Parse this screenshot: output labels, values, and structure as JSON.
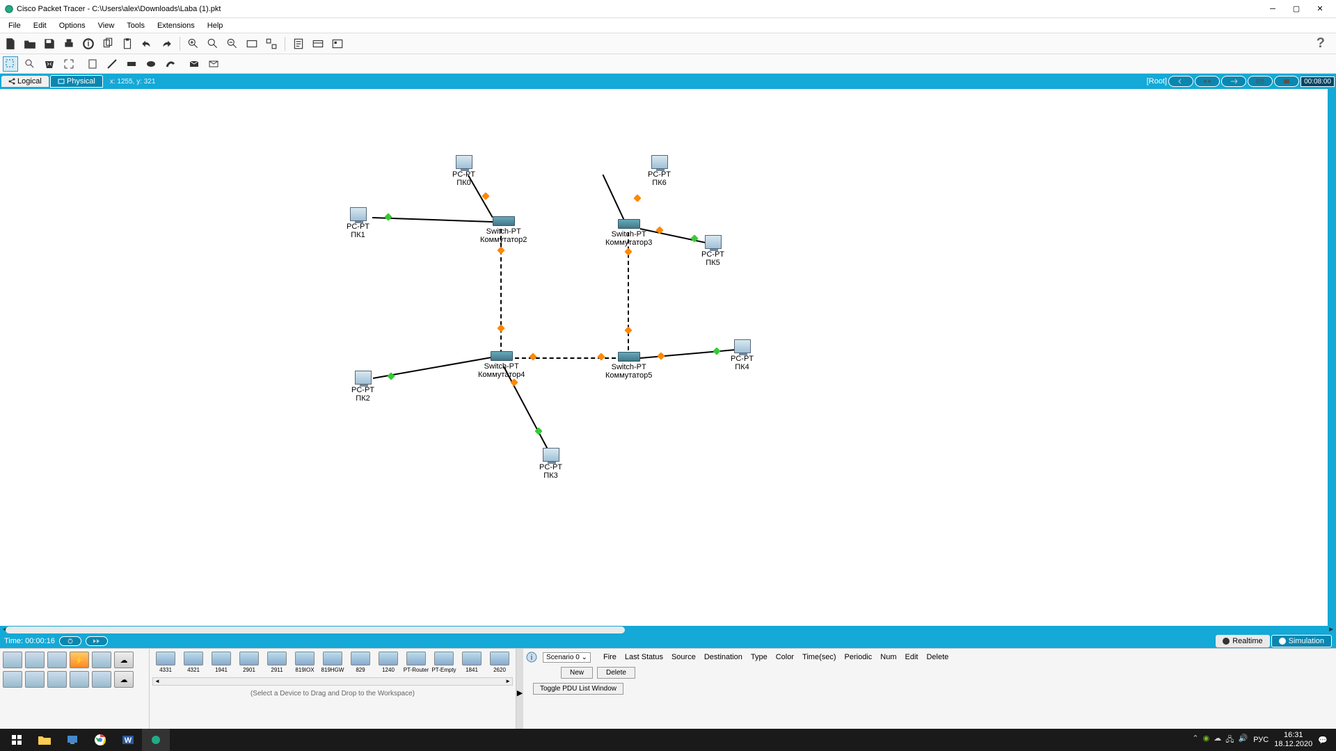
{
  "title_bar": {
    "app_title": "Cisco Packet Tracer - C:\\Users\\alex\\Downloads\\Laba (1).pkt"
  },
  "menu": {
    "file": "File",
    "edit": "Edit",
    "options": "Options",
    "view": "View",
    "tools": "Tools",
    "extensions": "Extensions",
    "help": "Help"
  },
  "view_bar": {
    "logical": "Logical",
    "physical": "Physical",
    "coords": "x: 1255, y: 321",
    "root": "[Root]",
    "clock": "00:08:00"
  },
  "time_bar": {
    "time_label": "Time: 00:00:16",
    "realtime": "Realtime",
    "simulation": "Simulation"
  },
  "devices": {
    "pc0": {
      "type": "PC-PT",
      "name": "ПК0"
    },
    "pc1": {
      "type": "PC-PT",
      "name": "ПК1"
    },
    "pc2": {
      "type": "PC-PT",
      "name": "ПК2"
    },
    "pc3": {
      "type": "PC-PT",
      "name": "ПК3"
    },
    "pc4": {
      "type": "PC-PT",
      "name": "ПК4"
    },
    "pc5": {
      "type": "PC-PT",
      "name": "ПК5"
    },
    "pc6": {
      "type": "PC-PT",
      "name": "ПК6"
    },
    "sw2": {
      "type": "Switch-PT",
      "name": "Коммутатор2"
    },
    "sw3": {
      "type": "Switch-PT",
      "name": "Коммутатор3"
    },
    "sw4": {
      "type": "Switch-PT",
      "name": "Коммутатор4"
    },
    "sw5": {
      "type": "Switch-PT",
      "name": "Коммутатор5"
    }
  },
  "device_models": [
    "4331",
    "4321",
    "1941",
    "2901",
    "2911",
    "819IOX",
    "819HGW",
    "829",
    "1240",
    "PT-Router",
    "PT-Empty",
    "1841",
    "2620"
  ],
  "pdu": {
    "scenario": "Scenario 0 ⌄",
    "headers": [
      "Fire",
      "Last Status",
      "Source",
      "Destination",
      "Type",
      "Color",
      "Time(sec)",
      "Periodic",
      "Num",
      "Edit",
      "Delete"
    ],
    "new_btn": "New",
    "delete_btn": "Delete",
    "toggle": "Toggle PDU List Window"
  },
  "drag_hint": "(Select a Device to Drag and Drop to the Workspace)",
  "taskbar": {
    "time": "16:31",
    "date": "18.12.2020",
    "lang": "РУС"
  }
}
